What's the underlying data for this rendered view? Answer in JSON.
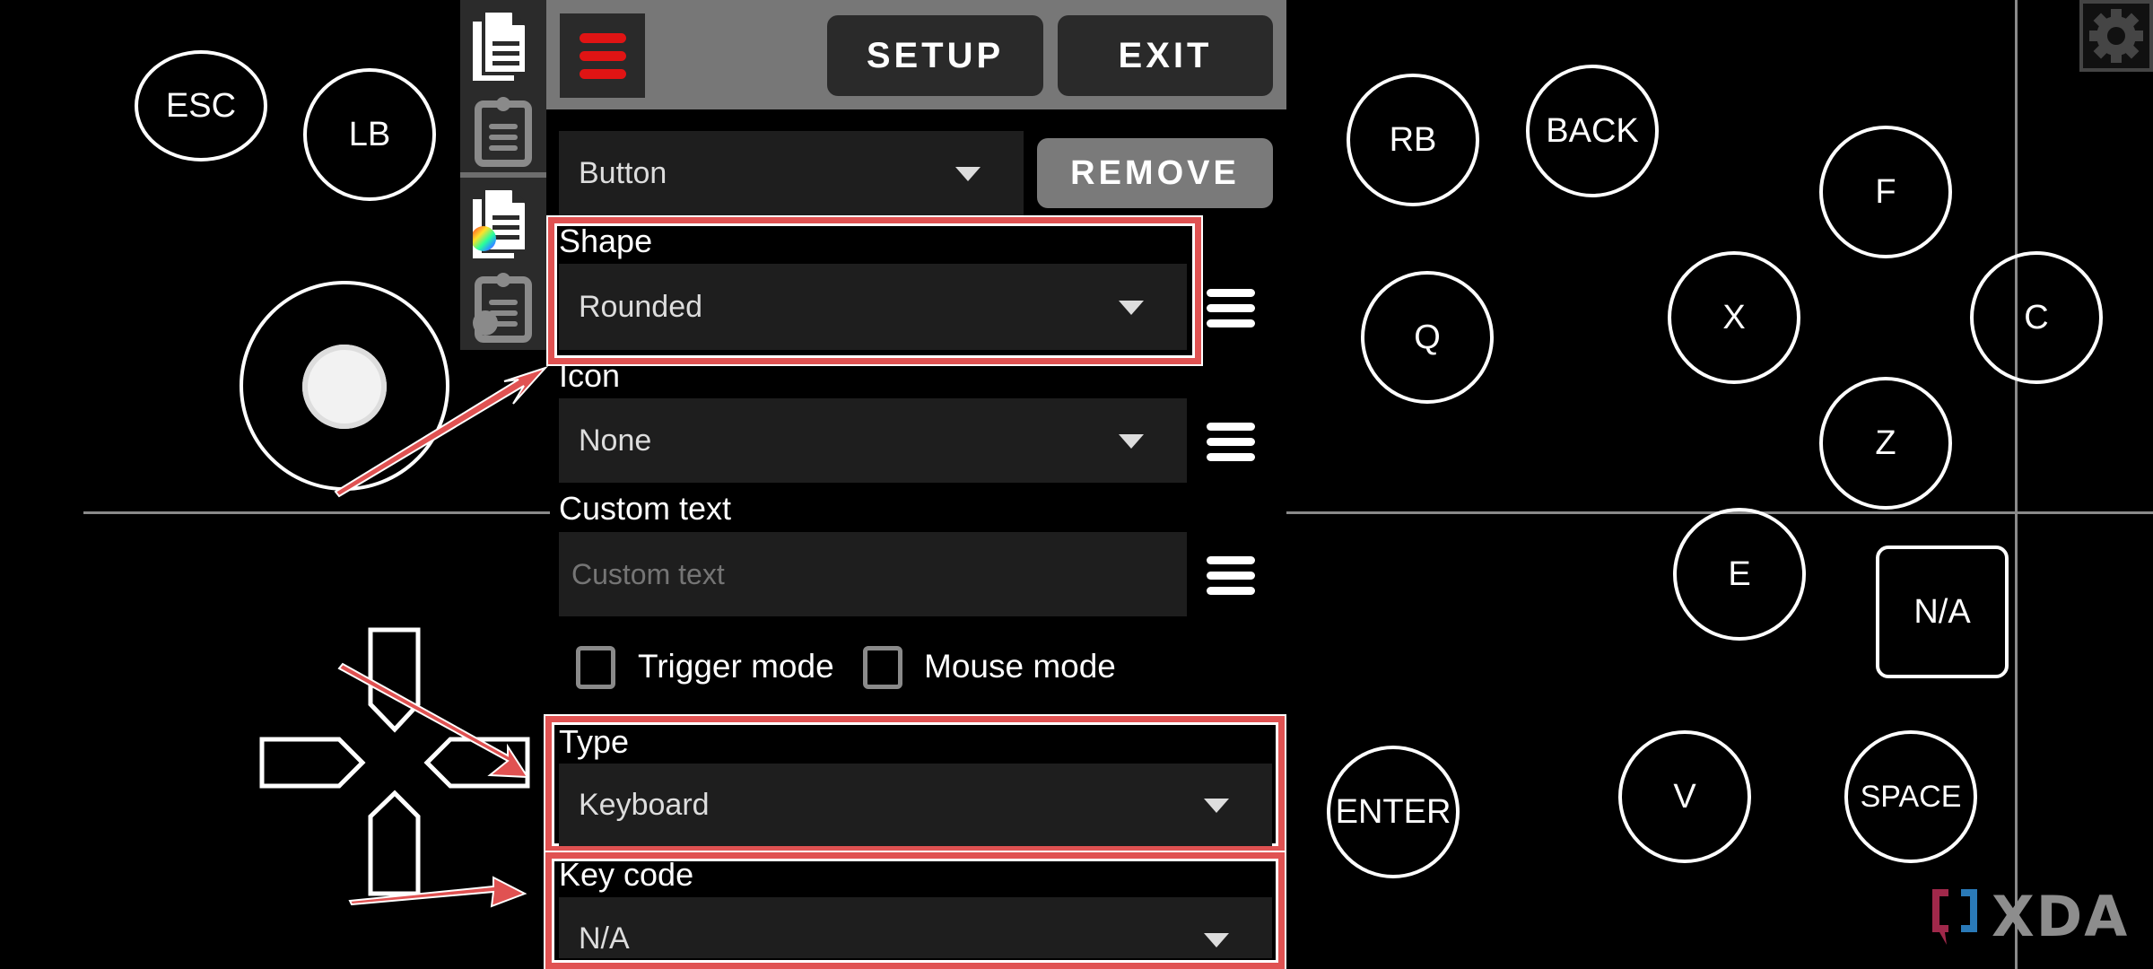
{
  "overlay_controls": {
    "esc": "ESC",
    "lb": "LB",
    "rb": "RB",
    "back": "BACK",
    "f": "F",
    "q": "Q",
    "x": "X",
    "c": "C",
    "z": "Z",
    "e": "E",
    "na": "N/A",
    "enter": "ENTER",
    "v": "V",
    "space": "SPACE"
  },
  "sidebar": {
    "icons": [
      "copy-document-icon",
      "clipboard-icon",
      "copy-style-icon",
      "paste-style-icon"
    ]
  },
  "toolbar": {
    "menu_icon": "hamburger-menu-icon",
    "setup_label": "SETUP",
    "exit_label": "EXIT"
  },
  "editor": {
    "element_type": {
      "value": "Button"
    },
    "remove_label": "REMOVE",
    "shape": {
      "label": "Shape",
      "value": "Rounded"
    },
    "icon": {
      "label": "Icon",
      "value": "None"
    },
    "custom_text": {
      "label": "Custom text",
      "placeholder": "Custom text",
      "value": ""
    },
    "trigger_mode": {
      "label": "Trigger mode",
      "checked": false
    },
    "mouse_mode": {
      "label": "Mouse mode",
      "checked": false
    },
    "type": {
      "label": "Type",
      "value": "Keyboard"
    },
    "key_code": {
      "label": "Key code",
      "value": "N/A"
    }
  },
  "annotation_colors": {
    "highlight": "#e05252",
    "accent_menu": "#e01414"
  },
  "watermark": {
    "text": "XDA"
  }
}
